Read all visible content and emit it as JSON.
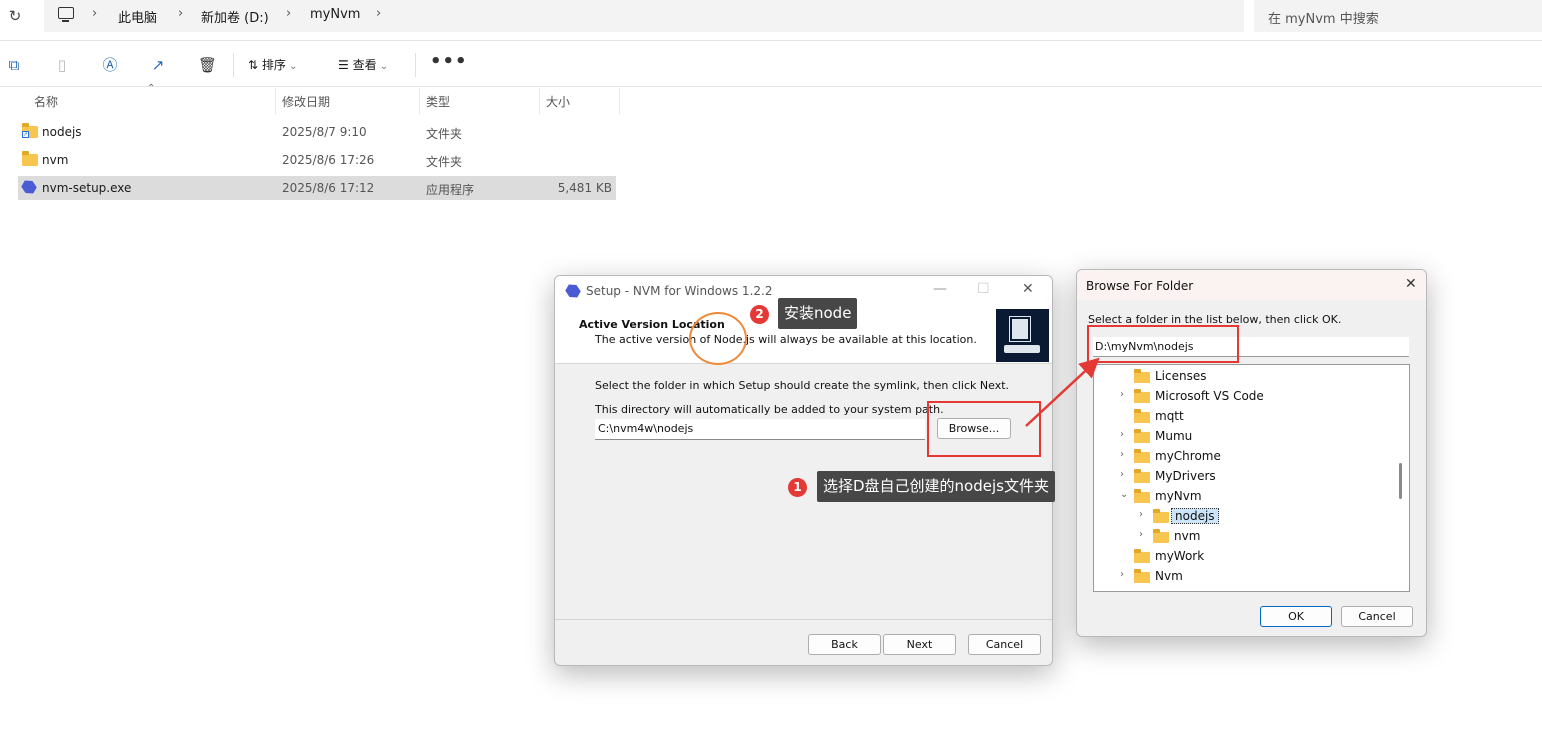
{
  "addressbar": {
    "crumbs": [
      "此电脑",
      "新加卷 (D:)",
      "myNvm"
    ],
    "search_placeholder": "在 myNvm 中搜索"
  },
  "toolbar": {
    "sort_label": "排序",
    "view_label": "查看",
    "more_label": "•••"
  },
  "filelist": {
    "columns": [
      "名称",
      "修改日期",
      "类型",
      "大小"
    ],
    "rows": [
      {
        "name": "nodejs",
        "date": "2025/8/7 9:10",
        "type": "文件夹",
        "size": ""
      },
      {
        "name": "nvm",
        "date": "2025/8/6 17:26",
        "type": "文件夹",
        "size": ""
      },
      {
        "name": "nvm-setup.exe",
        "date": "2025/8/6 17:12",
        "type": "应用程序",
        "size": "5,481 KB"
      }
    ]
  },
  "setup": {
    "title": "Setup - NVM for Windows 1.2.2",
    "heading": "Active Version Location",
    "subheading": "The active version of Node.js will always be available at this location.",
    "instruction": "Select the folder in which Setup should create the symlink, then click Next.",
    "path_note": "This directory will automatically be added to your system path.",
    "path_value": "C:\\nvm4w\\nodejs",
    "browse_label": "Browse...",
    "back_label": "Back",
    "next_label": "Next",
    "cancel_label": "Cancel"
  },
  "browse": {
    "title": "Browse For Folder",
    "tip": "Select a folder in the list below, then click OK.",
    "path_value": "D:\\myNvm\\nodejs",
    "tree": [
      {
        "label": "Licenses",
        "level": 0,
        "expander": ""
      },
      {
        "label": "Microsoft VS Code",
        "level": 0,
        "expander": "›"
      },
      {
        "label": "mqtt",
        "level": 0,
        "expander": ""
      },
      {
        "label": "Mumu",
        "level": 0,
        "expander": "›"
      },
      {
        "label": "myChrome",
        "level": 0,
        "expander": "›"
      },
      {
        "label": "MyDrivers",
        "level": 0,
        "expander": "›"
      },
      {
        "label": "myNvm",
        "level": 0,
        "expander": "⌄"
      },
      {
        "label": "nodejs",
        "level": 1,
        "expander": "›",
        "selected": true
      },
      {
        "label": "nvm",
        "level": 1,
        "expander": "›"
      },
      {
        "label": "myWork",
        "level": 0,
        "expander": ""
      },
      {
        "label": "Nvm",
        "level": 0,
        "expander": "›"
      }
    ],
    "ok_label": "OK",
    "cancel_label": "Cancel"
  },
  "annotations": {
    "step1_number": "1",
    "step1_text": "选择D盘自己创建的nodejs文件夹",
    "step2_number": "2",
    "step2_text": "安装node",
    "accent_color": "#e53935"
  }
}
